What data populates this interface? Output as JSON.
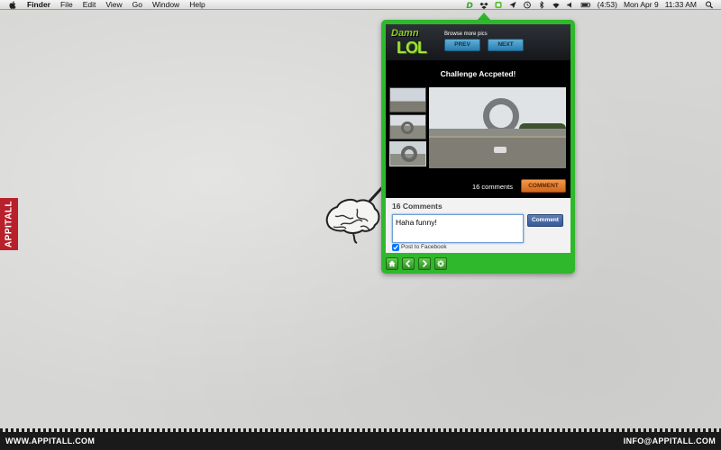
{
  "menubar": {
    "items": [
      "Finder",
      "File",
      "Edit",
      "View",
      "Go",
      "Window",
      "Help"
    ],
    "status_icons": [
      "dammlol-icon",
      "dropbox-icon",
      "evernote-icon",
      "location-icon",
      "time-machine-icon",
      "bluetooth-icon",
      "wifi-icon",
      "volume-icon",
      "battery-icon"
    ],
    "battery": "(4:53)",
    "day": "Mon Apr 9",
    "time": "11:33 AM"
  },
  "desktop": {
    "side_tab": "APPITALL",
    "footer_left": "WWW.APPITALL.COM",
    "footer_right": "INFO@APPITALL.COM"
  },
  "popup": {
    "logo_top": "Damn",
    "logo_bottom": "LOL",
    "browse_label": "Browse more pics",
    "prev_label": "PREV",
    "next_label": "NEXT",
    "photo_title": "Challenge Accpeted!",
    "comment_count": "16 comments",
    "comment_button": "COMMENT",
    "comments_heading": "16 Comments",
    "comment_input_value": "Haha funny!",
    "submit_label": "Comment",
    "post_to_facebook": "Post to Facebook",
    "post_to_facebook_checked": true,
    "toolbar": [
      "home-icon",
      "back-arrow-icon",
      "forward-arrow-icon",
      "settings-icon"
    ]
  },
  "colors": {
    "popup_green": "#2fb82c",
    "accent_orange": "#e07a2e",
    "nav_blue": "#3a8fc4",
    "side_tab_red": "#b8202a"
  }
}
